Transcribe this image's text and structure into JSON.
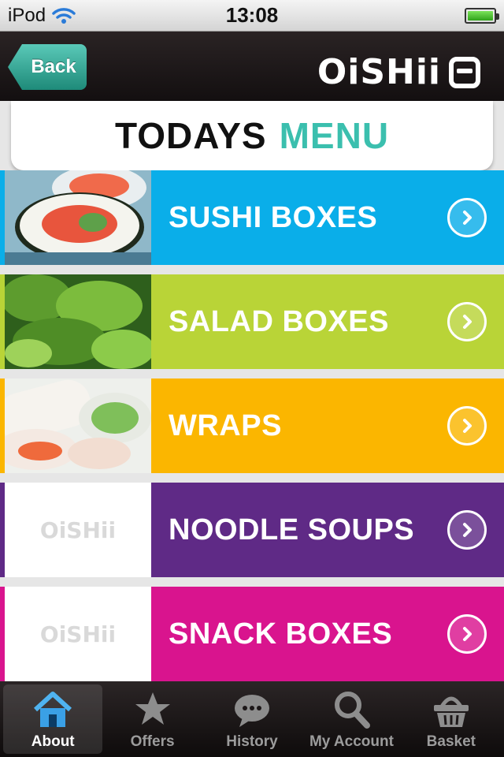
{
  "status": {
    "carrier": "iPod",
    "time": "13:08",
    "wifi_icon": "wifi-icon",
    "battery_icon": "battery-icon"
  },
  "nav": {
    "back_label": "Back",
    "logo_text": "OiSHii",
    "logo_icon": "lunchbox-icon"
  },
  "header": {
    "title_part1": "TODAYS",
    "title_part2": "MENU",
    "accent": "#3bbfae"
  },
  "categories": [
    {
      "label": "SUSHI BOXES",
      "color": "#0aaee9",
      "thumb": "sushi photo"
    },
    {
      "label": "SALAD BOXES",
      "color": "#b9d437",
      "thumb": "salad photo"
    },
    {
      "label": "WRAPS",
      "color": "#fbb600",
      "thumb": "wraps photo"
    },
    {
      "label": "NOODLE SOUPS",
      "color": "#5f2a86",
      "thumb_text": "OiSHii"
    },
    {
      "label": "SNACK BOXES",
      "color": "#d9148e",
      "thumb_text": "OiSHii"
    }
  ],
  "tabs": [
    {
      "label": "About",
      "icon": "home-icon",
      "active": true
    },
    {
      "label": "Offers",
      "icon": "star-icon",
      "active": false
    },
    {
      "label": "History",
      "icon": "chat-bubble-icon",
      "active": false
    },
    {
      "label": "My Account",
      "icon": "search-icon",
      "active": false
    },
    {
      "label": "Basket",
      "icon": "basket-icon",
      "active": false
    }
  ]
}
